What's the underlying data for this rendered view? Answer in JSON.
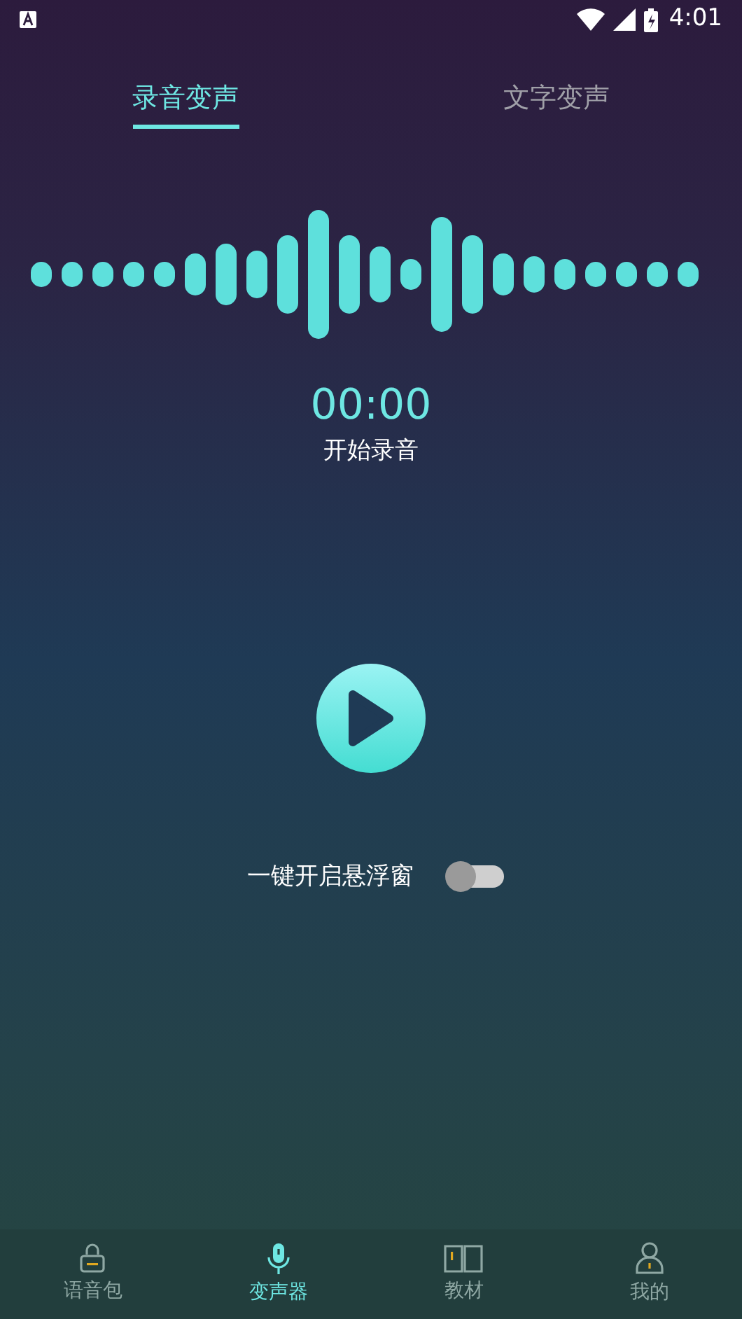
{
  "status_bar": {
    "time": "4:01"
  },
  "tabs": [
    {
      "label": "录音变声",
      "selected": true
    },
    {
      "label": "文字变声",
      "selected": false
    }
  ],
  "timer": "00:00",
  "record_label": "开始录音",
  "float_window": {
    "label": "一键开启悬浮窗",
    "on": false
  },
  "bottom_nav": [
    {
      "kind": "bag",
      "label": "语音包",
      "selected": false
    },
    {
      "kind": "mic",
      "label": "变声器",
      "selected": true
    },
    {
      "kind": "book",
      "label": "教材",
      "selected": false
    },
    {
      "kind": "person",
      "label": "我的",
      "selected": false
    }
  ]
}
